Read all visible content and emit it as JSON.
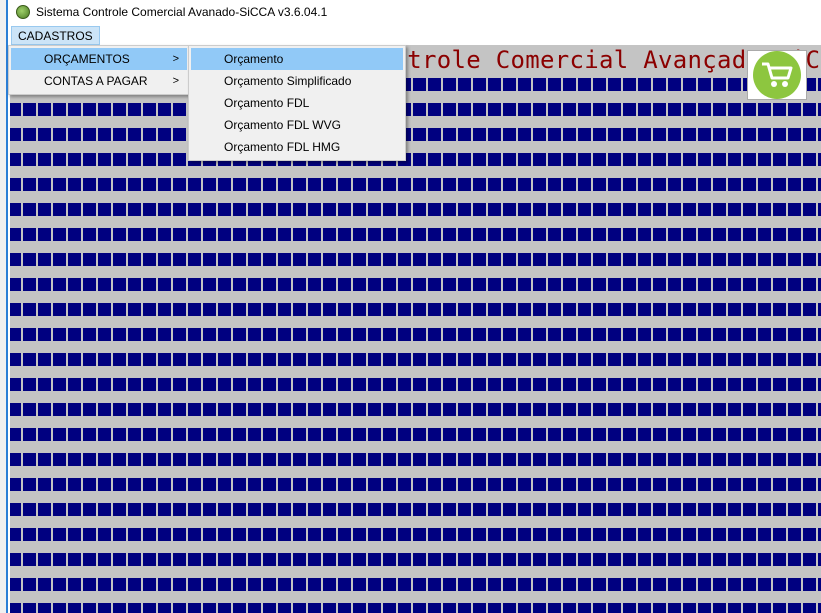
{
  "window": {
    "title": "Sistema Controle Comercial Avanado-SiCCA v3.6.04.1"
  },
  "menubar": {
    "items": [
      {
        "label": "CADASTROS"
      }
    ]
  },
  "cadastros_menu": {
    "items": [
      {
        "label": "ORÇAMENTOS",
        "has_submenu": true,
        "highlighted": true
      },
      {
        "label": "CONTAS A PAGAR",
        "has_submenu": true
      }
    ]
  },
  "orcamentos_submenu": {
    "items": [
      {
        "label": "Orçamento",
        "highlighted": true
      },
      {
        "label": "Orçamento Simplificado"
      },
      {
        "label": "Orçamento FDL"
      },
      {
        "label": "Orçamento FDL WVG"
      },
      {
        "label": "Orçamento FDL HMG"
      }
    ]
  },
  "main": {
    "banner_title": "Sistema Controle Comercial Avançado-SiCCA",
    "cart_icon": "shopping-cart-icon"
  },
  "colors": {
    "pattern": "#000080",
    "background": "#c4c4c4",
    "banner": "#8b0000",
    "highlight": "#91c9f7"
  }
}
